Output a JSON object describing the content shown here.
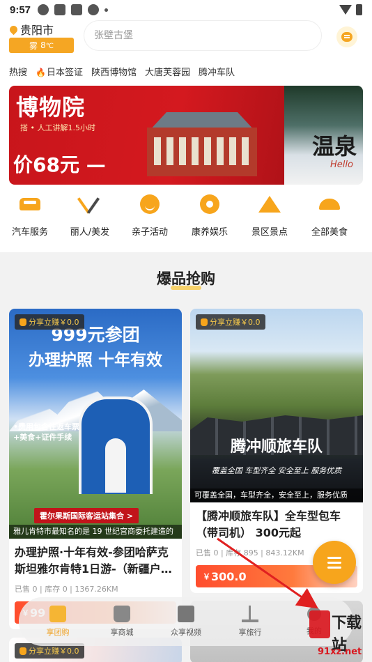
{
  "status_bar": {
    "time": "9:57"
  },
  "header": {
    "city": "贵阳市",
    "weather": {
      "condition": "雾",
      "temp": "8",
      "unit": "℃"
    },
    "search_placeholder": "张壁古堡"
  },
  "hot_search": {
    "label": "热搜",
    "items": [
      "日本签证",
      "陕西博物馆",
      "大唐芙蓉园",
      "腾冲车队"
    ]
  },
  "banner": {
    "title": "博物院",
    "subtitle": "搭 • 人工讲解1.5小时",
    "price": "价68元 —",
    "side_text": "温泉",
    "side_sub": "Hello"
  },
  "categories": [
    {
      "label": "汽车服务",
      "icon": "car-icon"
    },
    {
      "label": "丽人/美发",
      "icon": "beauty-icon"
    },
    {
      "label": "亲子活动",
      "icon": "kid-icon"
    },
    {
      "label": "康养娱乐",
      "icon": "music-icon"
    },
    {
      "label": "景区景点",
      "icon": "scenic-icon"
    },
    {
      "label": "全部美食",
      "icon": "food-icon"
    }
  ],
  "section": {
    "title": "爆品抢购"
  },
  "products": [
    {
      "share": "分享立赚￥0.0",
      "poster_line1": "999元参团",
      "poster_line2": "办理护照 十年有效",
      "bullets": [
        "•费用包含往返车票",
        "+美食+证件手续"
      ],
      "ribbon": "霍尔果斯国际客运站集合 >",
      "caption": "雅儿肯特市最知名的是 19 世纪宫商委托建造的",
      "title": "办理护照·十年有效-参团哈萨克斯坦雅尔肯特1日游-（新疆户…",
      "meta": "已售 0 | 库存 0 | 1367.26KM",
      "price_symbol": "￥",
      "price": "99"
    },
    {
      "share": "分享立赚￥0.0",
      "poster_title": "腾冲顺旅车队",
      "poster_sub": "覆盖全国  车型齐全  安全至上  服务优质",
      "caption": "可覆盖全国，车型齐全，安全至上，服务优质",
      "title": "【腾冲顺旅车队】全车型包车（带司机） 300元起",
      "meta": "已售 0 | 库存 895 | 843.12KM",
      "price_symbol": "￥",
      "price": "300.0"
    },
    {
      "share": "分享立赚￥0.0"
    }
  ],
  "bottom_nav": [
    {
      "label": "享团购",
      "icon": "group-buy-icon",
      "active": true
    },
    {
      "label": "享商城",
      "icon": "shop-bag-icon"
    },
    {
      "label": "众享视频",
      "icon": "video-icon"
    },
    {
      "label": "享旅行",
      "icon": "travel-icon"
    },
    {
      "label": "我的",
      "icon": "user-icon"
    }
  ],
  "watermark": {
    "text": "下载站",
    "url": "91xz.net"
  },
  "colors": {
    "accent": "#f7a51c",
    "price": "#ff4d2e",
    "arrow": "#e02020"
  }
}
